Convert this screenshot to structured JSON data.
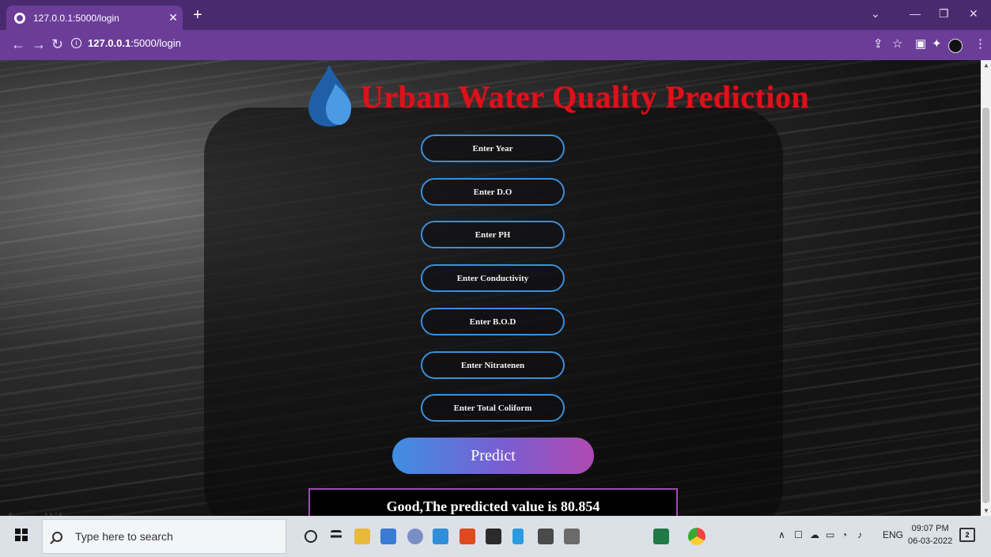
{
  "browser": {
    "tab_title": "127.0.0.1:5000/login",
    "url_host": "127.0.0.1",
    "url_rest": ":5000/login"
  },
  "app": {
    "title": "Urban Water Quality Prediction",
    "fields": [
      {
        "placeholder": "Enter Year"
      },
      {
        "placeholder": "Enter D.O"
      },
      {
        "placeholder": "Enter PH"
      },
      {
        "placeholder": "Enter Conductivity"
      },
      {
        "placeholder": "Enter B.O.D"
      },
      {
        "placeholder": "Enter Nitratenen"
      },
      {
        "placeholder": "Enter Total Coliform"
      }
    ],
    "predict_label": "Predict",
    "result_text": "Good,The predicted value is 80.854",
    "watermark": "headlikeanorange"
  },
  "taskbar": {
    "search_placeholder": "Type here to search",
    "lang": "ENG",
    "time": "09:07 PM",
    "date": "06-03-2022",
    "notif_count": "2"
  }
}
